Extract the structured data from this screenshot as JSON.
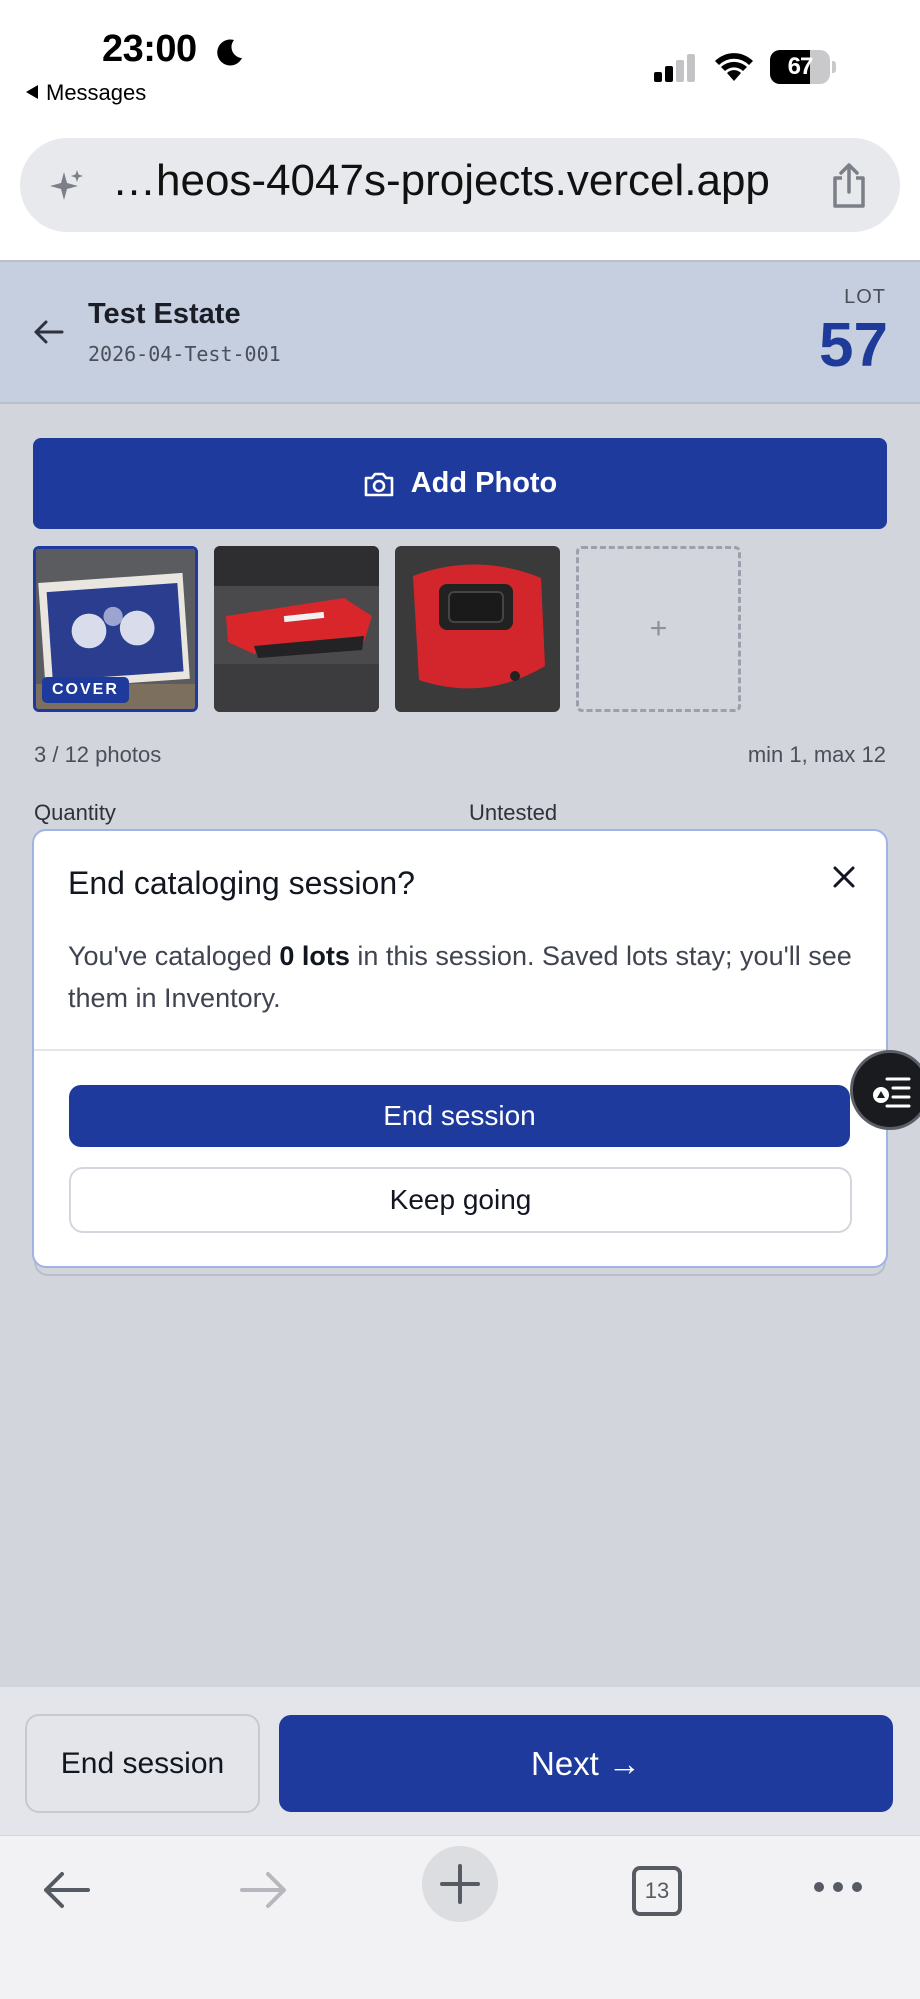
{
  "status_bar": {
    "time": "23:00",
    "back_app": "Messages",
    "battery_level": "67",
    "battery_fraction": 0.67
  },
  "browser": {
    "url": "…heos-4047s-projects.vercel.app",
    "tab_count": "13"
  },
  "header": {
    "estate_name": "Test Estate",
    "estate_code": "2026-04-Test-001",
    "lot_label": "LOT",
    "lot_number": "57"
  },
  "photos": {
    "add_label": "Add Photo",
    "cover_badge": "COVER",
    "add_tile_symbol": "+",
    "count_text": "3 / 12 photos",
    "limits_text": "min 1, max 12",
    "items": [
      "playing-card-deck",
      "red-utility-knife",
      "red-tape-measure"
    ]
  },
  "form": {
    "quantity_label": "Quantity",
    "untested_label": "Untested"
  },
  "dialog": {
    "title": "End cataloging session?",
    "body_prefix": "You've cataloged ",
    "body_bold": "0 lots",
    "body_suffix": " in this session. Saved lots stay; you'll see them in Inventory.",
    "primary_button": "End session",
    "secondary_button": "Keep going"
  },
  "footer": {
    "end_session_label": "End session",
    "next_label": "Next →"
  },
  "colors": {
    "primary": "#1e3a9c",
    "header_bg": "#c6cfe0",
    "overlay_bg": "#d2d5dc"
  },
  "icons": [
    "moon-icon",
    "signal-icon",
    "wifi-icon",
    "battery-icon",
    "sparkle-icon",
    "share-icon",
    "back-arrow-icon",
    "camera-icon",
    "close-icon",
    "reader-icon",
    "browser-back-icon",
    "browser-forward-icon",
    "new-tab-icon",
    "tabs-icon",
    "more-icon"
  ]
}
